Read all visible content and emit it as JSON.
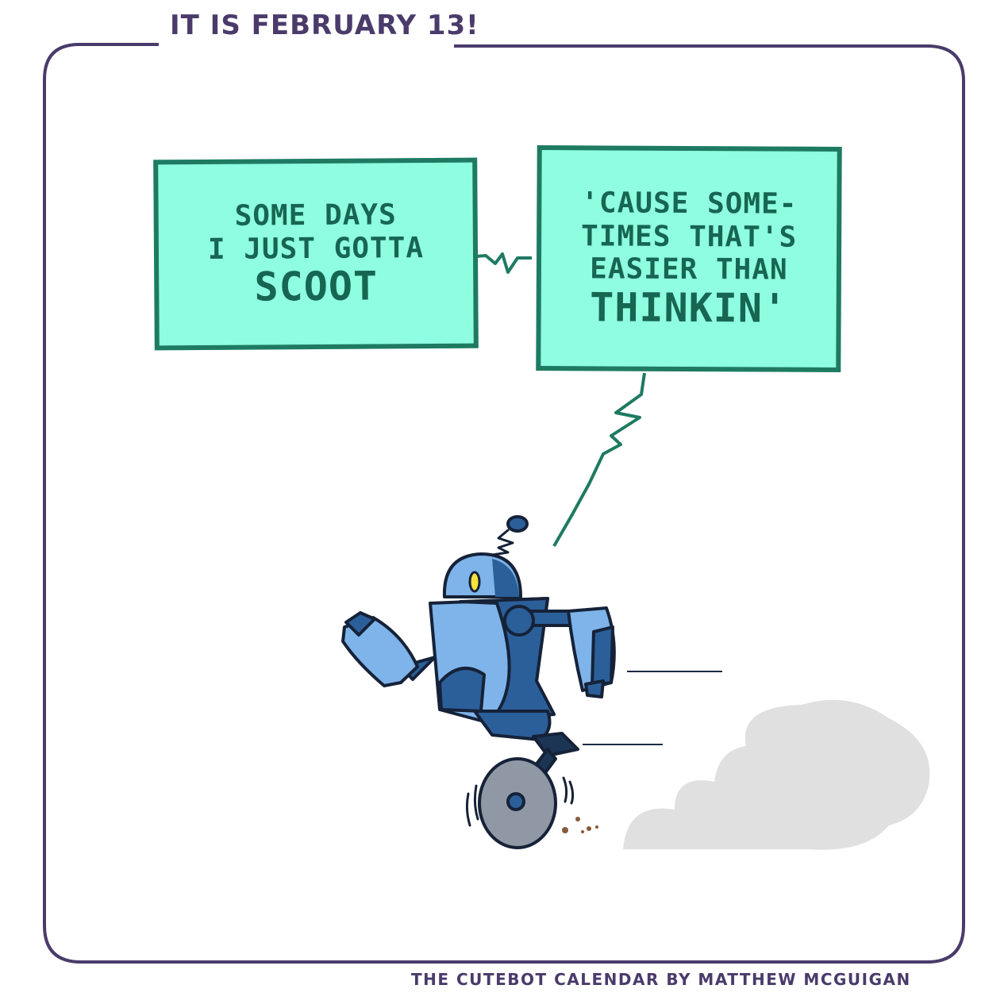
{
  "header": {
    "title": "IT IS FEBRUARY 13!"
  },
  "bubbles": [
    {
      "lines": [
        "SOME DAYS",
        "I JUST GOTTA"
      ],
      "emphasis": "SCOOT"
    },
    {
      "lines": [
        "'CAUSE SOME-",
        "TIMES THAT'S",
        "EASIER THAN"
      ],
      "emphasis": "THINKIN'"
    }
  ],
  "footer": {
    "credit": "THE CUTEBOT CALENDAR BY MATTHEW MCGUIGAN"
  },
  "colors": {
    "frame": "#4a3b6b",
    "bubble_fill": "#8efde0",
    "bubble_border": "#1f7a62",
    "robot_light": "#7eb4ea",
    "robot_dark": "#2b5f9a",
    "wheel": "#8f98a4",
    "dust": "#e0e0e0"
  },
  "icons": [
    "robot-character",
    "unicycle-wheel-icon",
    "dust-cloud-icon",
    "antenna-icon"
  ]
}
